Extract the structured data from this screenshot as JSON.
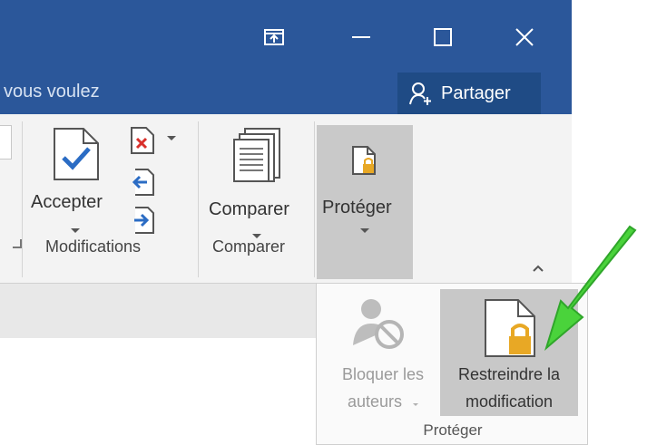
{
  "titlebar": {
    "tell_me_text": "vous voulez",
    "share_label": "Partager",
    "controls": [
      "ribbon-display-icon",
      "minimize-icon",
      "maximize-icon",
      "close-icon"
    ]
  },
  "ribbon": {
    "groups": {
      "modifications": {
        "label": "Modifications",
        "accept_label": "Accepter"
      },
      "comparer": {
        "label": "Comparer",
        "compare_label": "Comparer"
      },
      "proteger": {
        "protect_label": "Protéger"
      }
    }
  },
  "dropdown": {
    "block_authors_line1": "Bloquer les",
    "block_authors_line2": "auteurs",
    "restrict_line1": "Restreindre la",
    "restrict_line2": "modification",
    "group_label": "Protéger"
  },
  "colors": {
    "titlebar": "#2b579a",
    "arrow": "#4ad33b"
  }
}
